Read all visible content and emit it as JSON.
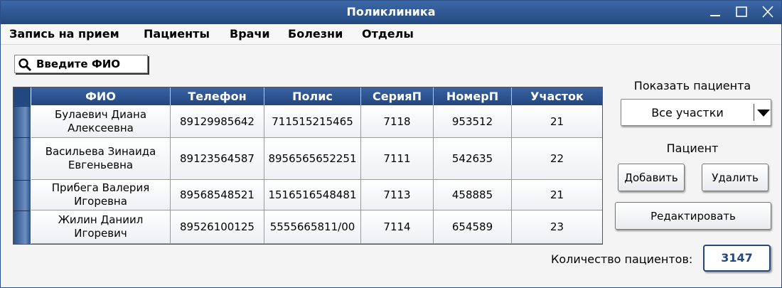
{
  "window": {
    "title": "Поликлиника"
  },
  "menu": [
    "Запись на прием",
    "Пациенты",
    "Врачи",
    "Болезни",
    "Отделы"
  ],
  "search": {
    "placeholder": "Введите ФИО"
  },
  "table": {
    "columns": [
      "ФИО",
      "Телефон",
      "Полис",
      "СерияП",
      "НомерП",
      "Участок"
    ],
    "rows": [
      {
        "fio": "Булаевич Диана Алексеевна",
        "phone": "89129985642",
        "polis": "711515215465",
        "series": "7118",
        "number": "953512",
        "district": "21"
      },
      {
        "fio": "Васильева Зинаида Евгеньевна",
        "phone": "89123564587",
        "polis": "8956565652251",
        "series": "7111",
        "number": "542635",
        "district": "22"
      },
      {
        "fio": "Прибега Валерия Игоревна",
        "phone": "89568548521",
        "polis": "1516516548481",
        "series": "7113",
        "number": "458885",
        "district": "21"
      },
      {
        "fio": "Жилин Даниил Игоревич",
        "phone": "89526100125",
        "polis": "5555665811/00",
        "series": "7114",
        "number": "654589",
        "district": "23"
      }
    ]
  },
  "filter": {
    "label": "Показать пациента",
    "selected": "Все участки"
  },
  "patient": {
    "label": "Пациент",
    "add": "Добавить",
    "delete": "Удалить",
    "edit": "Редактировать"
  },
  "footer": {
    "count_label": "Количество пациентов:",
    "count_value": "3147"
  },
  "colors": {
    "accent": "#23477f",
    "header": "#2b4f88"
  }
}
